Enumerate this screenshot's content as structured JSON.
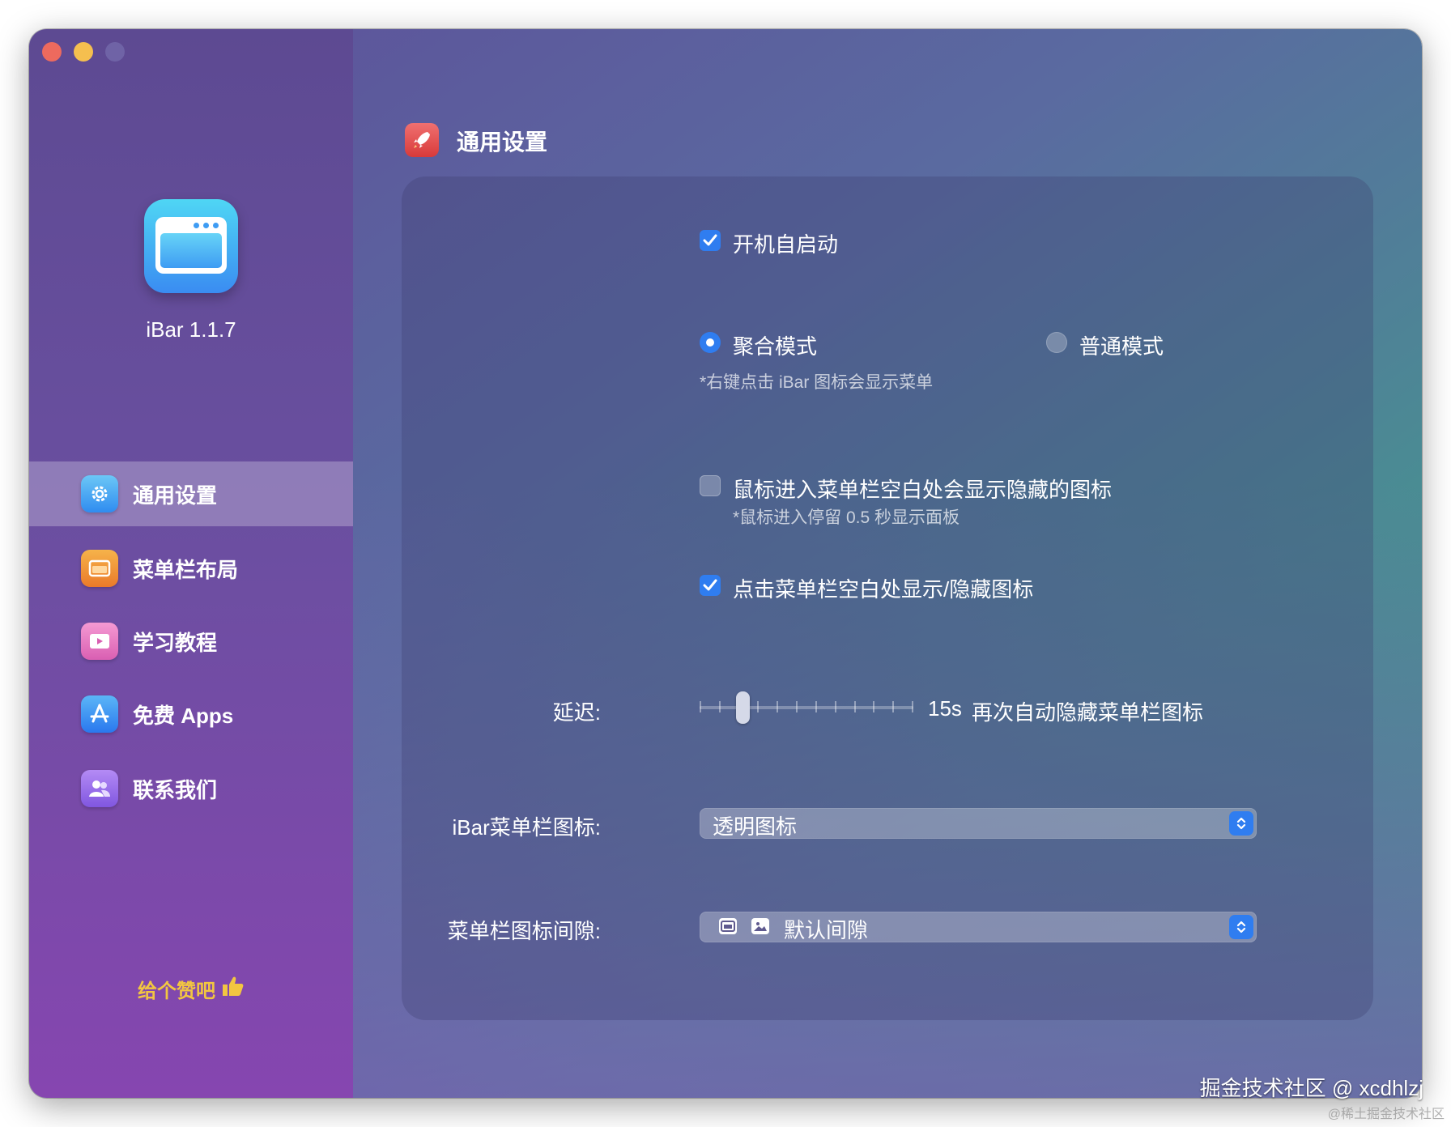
{
  "sidebar": {
    "app_version": "iBar 1.1.7",
    "items": [
      {
        "label": "通用设置",
        "icon": "gear-icon",
        "color": "#3f9ef0",
        "active": true
      },
      {
        "label": "菜单栏布局",
        "icon": "window-icon",
        "color": "#f29a35",
        "active": false
      },
      {
        "label": "学习教程",
        "icon": "video-icon",
        "color": "#e573c0",
        "active": false
      },
      {
        "label": "免费 Apps",
        "icon": "appstore-icon",
        "color": "#3b8ef1",
        "active": false
      },
      {
        "label": "联系我们",
        "icon": "people-icon",
        "color": "#9a6ce9",
        "active": false
      }
    ],
    "like": "给个赞吧"
  },
  "main": {
    "title": "通用设置",
    "launch_at_login": {
      "label": "开机自启动",
      "checked": true
    },
    "mode": {
      "options": [
        {
          "label": "聚合模式",
          "selected": true
        },
        {
          "label": "普通模式",
          "selected": false
        }
      ],
      "note": "*右键点击 iBar 图标会显示菜单"
    },
    "hover_show": {
      "label": "鼠标进入菜单栏空白处会显示隐藏的图标",
      "note": "*鼠标进入停留 0.5 秒显示面板",
      "checked": false
    },
    "click_toggle": {
      "label": "点击菜单栏空白处显示/隐藏图标",
      "checked": true
    },
    "delay": {
      "label": "延迟:",
      "value": "15s",
      "suffix": "再次自动隐藏菜单栏图标",
      "slider_fraction": 0.2
    },
    "menu_icon": {
      "label": "iBar菜单栏图标:",
      "value": "透明图标"
    },
    "icon_spacing": {
      "label": "菜单栏图标间隙:",
      "value": "默认间隙"
    }
  },
  "watermark": {
    "primary": "掘金技术社区 @ xcdhlzj",
    "secondary": "@稀土掘金技术社区"
  }
}
